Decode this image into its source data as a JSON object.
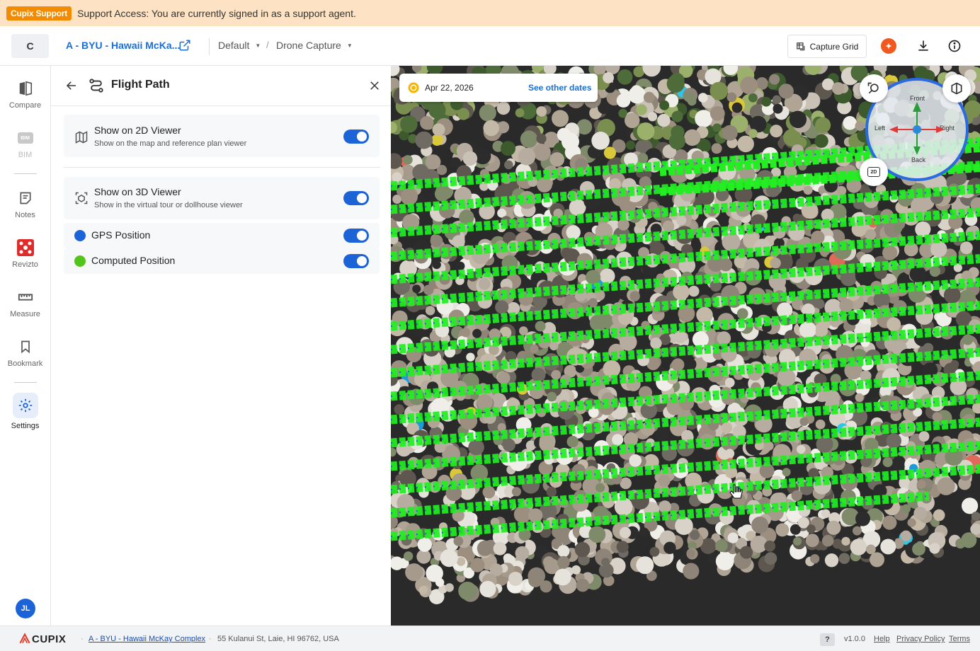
{
  "banner": {
    "tag": "Cupix Support",
    "message": "Support Access: You are currently signed in as a support agent."
  },
  "header": {
    "project_initial": "C",
    "project_name": "A - BYU - Hawaii McKa...",
    "breadcrumb": [
      "Default",
      "Drone Capture"
    ],
    "capture_grid_label": "Capture Grid"
  },
  "rail": {
    "items": [
      {
        "label": "Compare",
        "icon": "compare-icon"
      },
      {
        "label": "BIM",
        "icon": "bim-icon",
        "disabled": true
      },
      {
        "label": "Notes",
        "icon": "notes-icon"
      },
      {
        "label": "Revizto",
        "icon": "revizto-icon"
      },
      {
        "label": "Measure",
        "icon": "ruler-icon"
      },
      {
        "label": "Bookmark",
        "icon": "bookmark-icon"
      },
      {
        "label": "Settings",
        "icon": "gear-icon",
        "active": true
      }
    ],
    "user_initials": "JL"
  },
  "panel": {
    "title": "Flight Path",
    "viewer2d": {
      "title": "Show on 2D Viewer",
      "subtitle": "Show on the map and reference plan viewer",
      "enabled": true
    },
    "viewer3d": {
      "title": "Show on 3D Viewer",
      "subtitle": "Show in the virtual tour or dollhouse viewer",
      "enabled": true
    },
    "gps": {
      "label": "GPS Position",
      "color": "#1d63d8",
      "enabled": true
    },
    "computed": {
      "label": "Computed Position",
      "color": "#52c41a",
      "enabled": true
    }
  },
  "viewer": {
    "date": "Apr 22, 2026",
    "see_other_dates": "See other dates",
    "compass": {
      "front": "Front",
      "left": "Left",
      "right": "Right",
      "back": "Back"
    },
    "minimap_label": "2D"
  },
  "footer": {
    "logo": "CUPIX",
    "project_link": "A - BYU - Hawaii McKay Complex",
    "address": "55 Kulanui St, Laie, HI 96762, USA",
    "help_symbol": "?",
    "version": "v1.0.0",
    "help": "Help",
    "privacy": "Privacy Policy",
    "terms": "Terms"
  },
  "colors": {
    "accent": "#1d63d8",
    "banner_bg": "#fde2c3",
    "support_tag": "#f28b00",
    "flight_path": "#22ee22"
  }
}
